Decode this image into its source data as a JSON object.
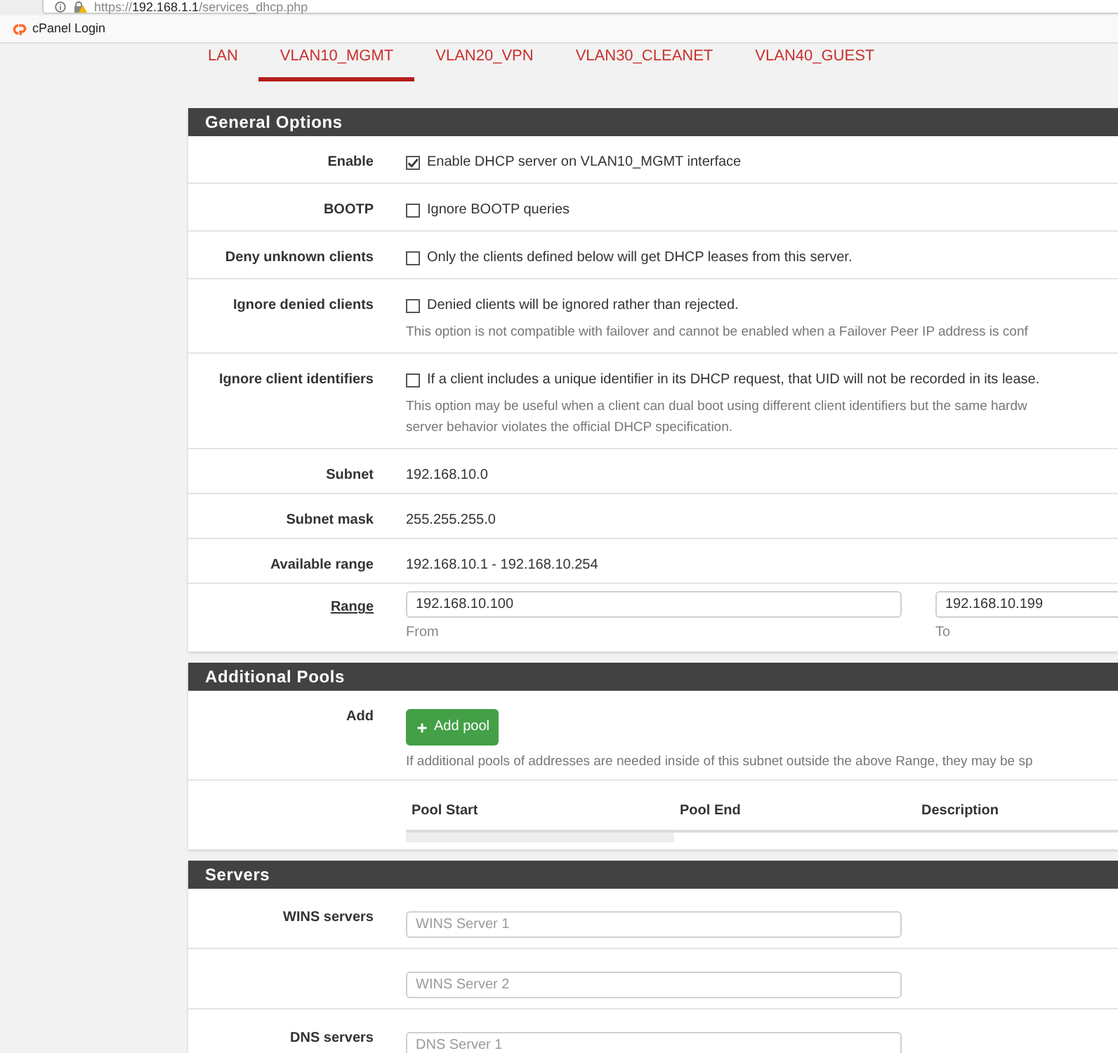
{
  "browser": {
    "url": {
      "scheme": "https://",
      "host": "192.168.1.1",
      "path": "/services_dhcp.php"
    },
    "bookmarks": [
      {
        "label": "cPanel Login"
      }
    ]
  },
  "tabs": [
    {
      "label": "LAN",
      "selected": false
    },
    {
      "label": "VLAN10_MGMT",
      "selected": true
    },
    {
      "label": "VLAN20_VPN",
      "selected": false
    },
    {
      "label": "VLAN30_CLEANET",
      "selected": false
    },
    {
      "label": "VLAN40_GUEST",
      "selected": false
    }
  ],
  "sections": [
    {
      "title": "General Options",
      "rows": [
        {
          "kind": "checkbox",
          "label": "Enable",
          "checked": true,
          "text": "Enable DHCP server on VLAN10_MGMT interface"
        },
        {
          "kind": "checkbox",
          "label": "BOOTP",
          "checked": false,
          "text": "Ignore BOOTP queries"
        },
        {
          "kind": "checkbox",
          "label": "Deny unknown clients",
          "checked": false,
          "text": "Only the clients defined below will get DHCP leases from this server."
        },
        {
          "kind": "checkbox",
          "label": "Ignore denied clients",
          "checked": false,
          "text": "Denied clients will be ignored rather than rejected.",
          "help": [
            "This option is not compatible with failover and cannot be enabled when a Failover Peer IP address is conf"
          ]
        },
        {
          "kind": "checkbox",
          "label": "Ignore client identifiers",
          "checked": false,
          "text": "If a client includes a unique identifier in its DHCP request, that UID will not be recorded in its lease.",
          "help": [
            "This option may be useful when a client can dual boot using different client identifiers but the same hardw",
            "server behavior violates the official DHCP specification."
          ]
        },
        {
          "kind": "value",
          "label": "Subnet",
          "value": "192.168.10.0"
        },
        {
          "kind": "value",
          "label": "Subnet mask",
          "value": "255.255.255.0"
        },
        {
          "kind": "value",
          "label": "Available range",
          "value": "192.168.10.1 - 192.168.10.254"
        },
        {
          "kind": "range",
          "label": "Range",
          "underlined": true,
          "from": {
            "value": "192.168.10.100",
            "caption": "From"
          },
          "to": {
            "value": "192.168.10.199",
            "caption": "To"
          }
        }
      ]
    },
    {
      "title": "Additional Pools",
      "rows": [
        {
          "kind": "button",
          "label": "Add",
          "button": "Add pool",
          "help": [
            "If additional pools of addresses are needed inside of this subnet outside the above Range, they may be sp"
          ]
        },
        {
          "kind": "table",
          "columns": [
            "Pool Start",
            "Pool End",
            "Description"
          ]
        }
      ]
    },
    {
      "title": "Servers",
      "rows": [
        {
          "kind": "input",
          "label": "WINS servers",
          "placeholder": "WINS Server 1"
        },
        {
          "kind": "input",
          "placeholder": "WINS Server 2"
        },
        {
          "kind": "input",
          "label": "DNS servers",
          "placeholder": "DNS Server 1"
        }
      ]
    }
  ]
}
